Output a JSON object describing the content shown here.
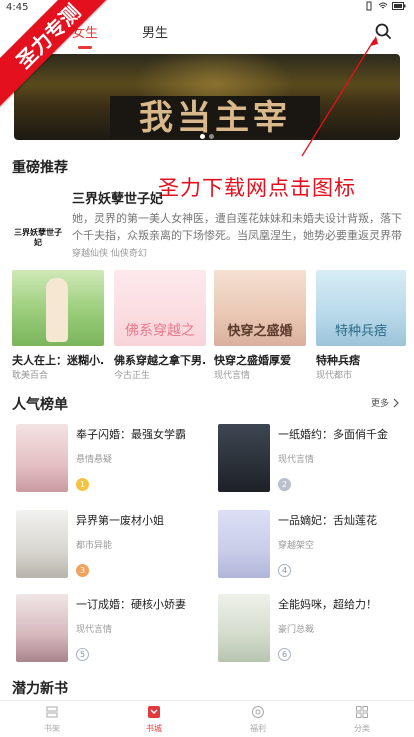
{
  "status": {
    "time": "4:45"
  },
  "ribbon": {
    "text": "圣力专测"
  },
  "tabs": [
    {
      "label": "女生",
      "active": true
    },
    {
      "label": "男生",
      "active": false
    }
  ],
  "banner": {
    "text": "我当主宰"
  },
  "annotation": "圣力下载网点击图标",
  "featured_section": {
    "title": "重磅推荐"
  },
  "featured": {
    "title": "三界妖孽世子妃",
    "desc": "她，灵界的第一美人女神医，遭自莲花妹妹和未婚夫设计背叛，落下个千夫指，众叛亲离的下场惨死。当凤凰涅生，她势必要重返灵界带那一对狗男女",
    "tags": "穿越仙侠  仙侠奇幻",
    "cover_text": "三界妖孽世子妃"
  },
  "grid": [
    {
      "title": "夫人在上：迷糊小...",
      "tag": "耽美百合"
    },
    {
      "title": "佛系穿越之拿下男...",
      "tag": "今古正生"
    },
    {
      "title": "快穿之盛婚厚爱",
      "tag": "现代言情"
    },
    {
      "title": "特种兵痞",
      "tag": "现代都市"
    }
  ],
  "popular": {
    "title": "人气榜单",
    "more": "更多"
  },
  "ranks": [
    {
      "title": "奉子闪婚：最强女学霸",
      "tag": "悬情悬疑",
      "rank": "1"
    },
    {
      "title": "一纸婚约：多面俏千金",
      "tag": "现代言情",
      "rank": "2"
    },
    {
      "title": "异界第一废材小姐",
      "tag": "都市异能",
      "rank": "3"
    },
    {
      "title": "一品嫡妃：舌灿莲花",
      "tag": "穿越架空",
      "rank": "4"
    },
    {
      "title": "一订成婚：硬核小娇妻",
      "tag": "现代言情",
      "rank": "5"
    },
    {
      "title": "全能妈咪，超给力！",
      "tag": "豪门总裁",
      "rank": "6"
    }
  ],
  "potential": {
    "title": "潜力新书"
  },
  "bottom_nav": [
    {
      "label": "书架",
      "icon": "bookshelf-icon"
    },
    {
      "label": "书城",
      "icon": "bookstore-icon",
      "active": true
    },
    {
      "label": "福利",
      "icon": "welfare-icon"
    },
    {
      "label": "分类",
      "icon": "category-icon"
    }
  ],
  "colors": {
    "accent": "#e4393c",
    "ribbon": "#e4101d",
    "annotation": "#e4101d"
  }
}
